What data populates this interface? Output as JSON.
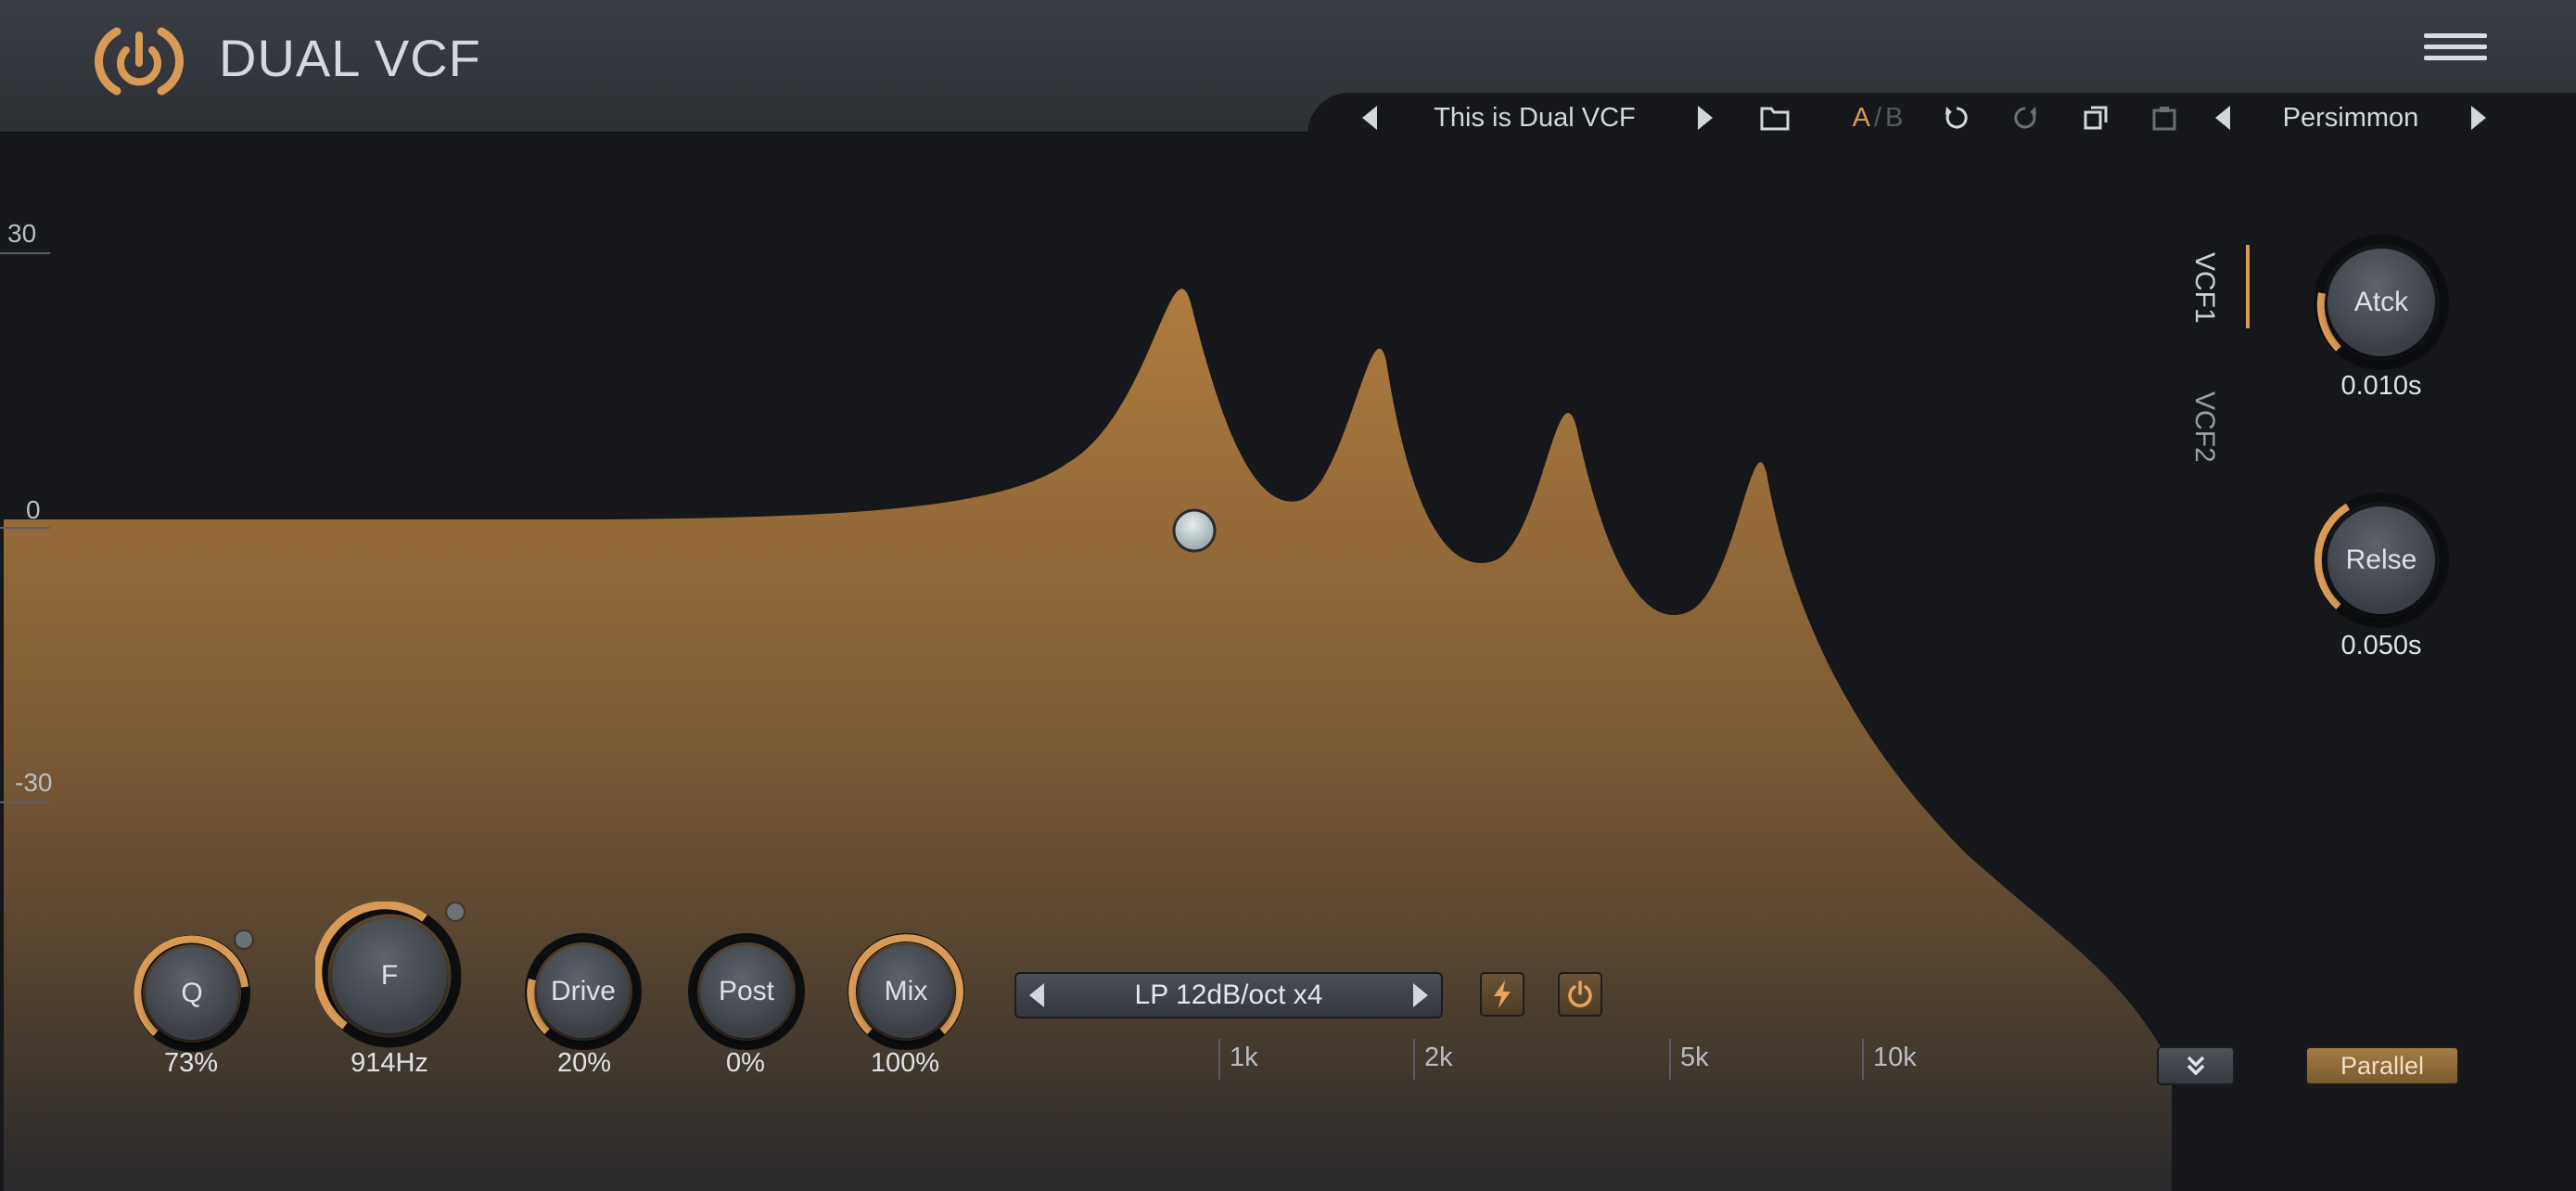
{
  "app": {
    "title": "DUAL VCF"
  },
  "toolbar": {
    "preset_name": "This is Dual VCF",
    "ab_a": "A",
    "ab_sep": "/",
    "ab_b": "B",
    "theme_name": "Persimmon"
  },
  "graph": {
    "db_labels": [
      "30",
      "0",
      "-30"
    ],
    "freq_labels": [
      "1k",
      "2k",
      "5k",
      "10k"
    ],
    "fill_color": "#a0723c"
  },
  "knobs": [
    {
      "label": "Q",
      "value": "73%"
    },
    {
      "label": "F",
      "value": "914Hz"
    },
    {
      "label": "Drive",
      "value": "20%"
    },
    {
      "label": "Post",
      "value": "0%"
    },
    {
      "label": "Mix",
      "value": "100%"
    }
  ],
  "filter_type": "LP 12dB/oct x4",
  "envelope": [
    {
      "label": "Atck",
      "value": "0.010s"
    },
    {
      "label": "Relse",
      "value": "0.050s"
    }
  ],
  "tabs": [
    "VCF1",
    "VCF2"
  ],
  "routing": "Parallel",
  "colors": {
    "accent": "#d89a55",
    "background": "#15171b",
    "header": "#33363b"
  },
  "icons": [
    "power-logo-icon",
    "hamburger-menu-icon",
    "folder-icon",
    "undo-icon",
    "redo-icon",
    "copy-icon",
    "paste-icon",
    "lightning-icon",
    "power-icon",
    "double-chevron-down-icon"
  ]
}
